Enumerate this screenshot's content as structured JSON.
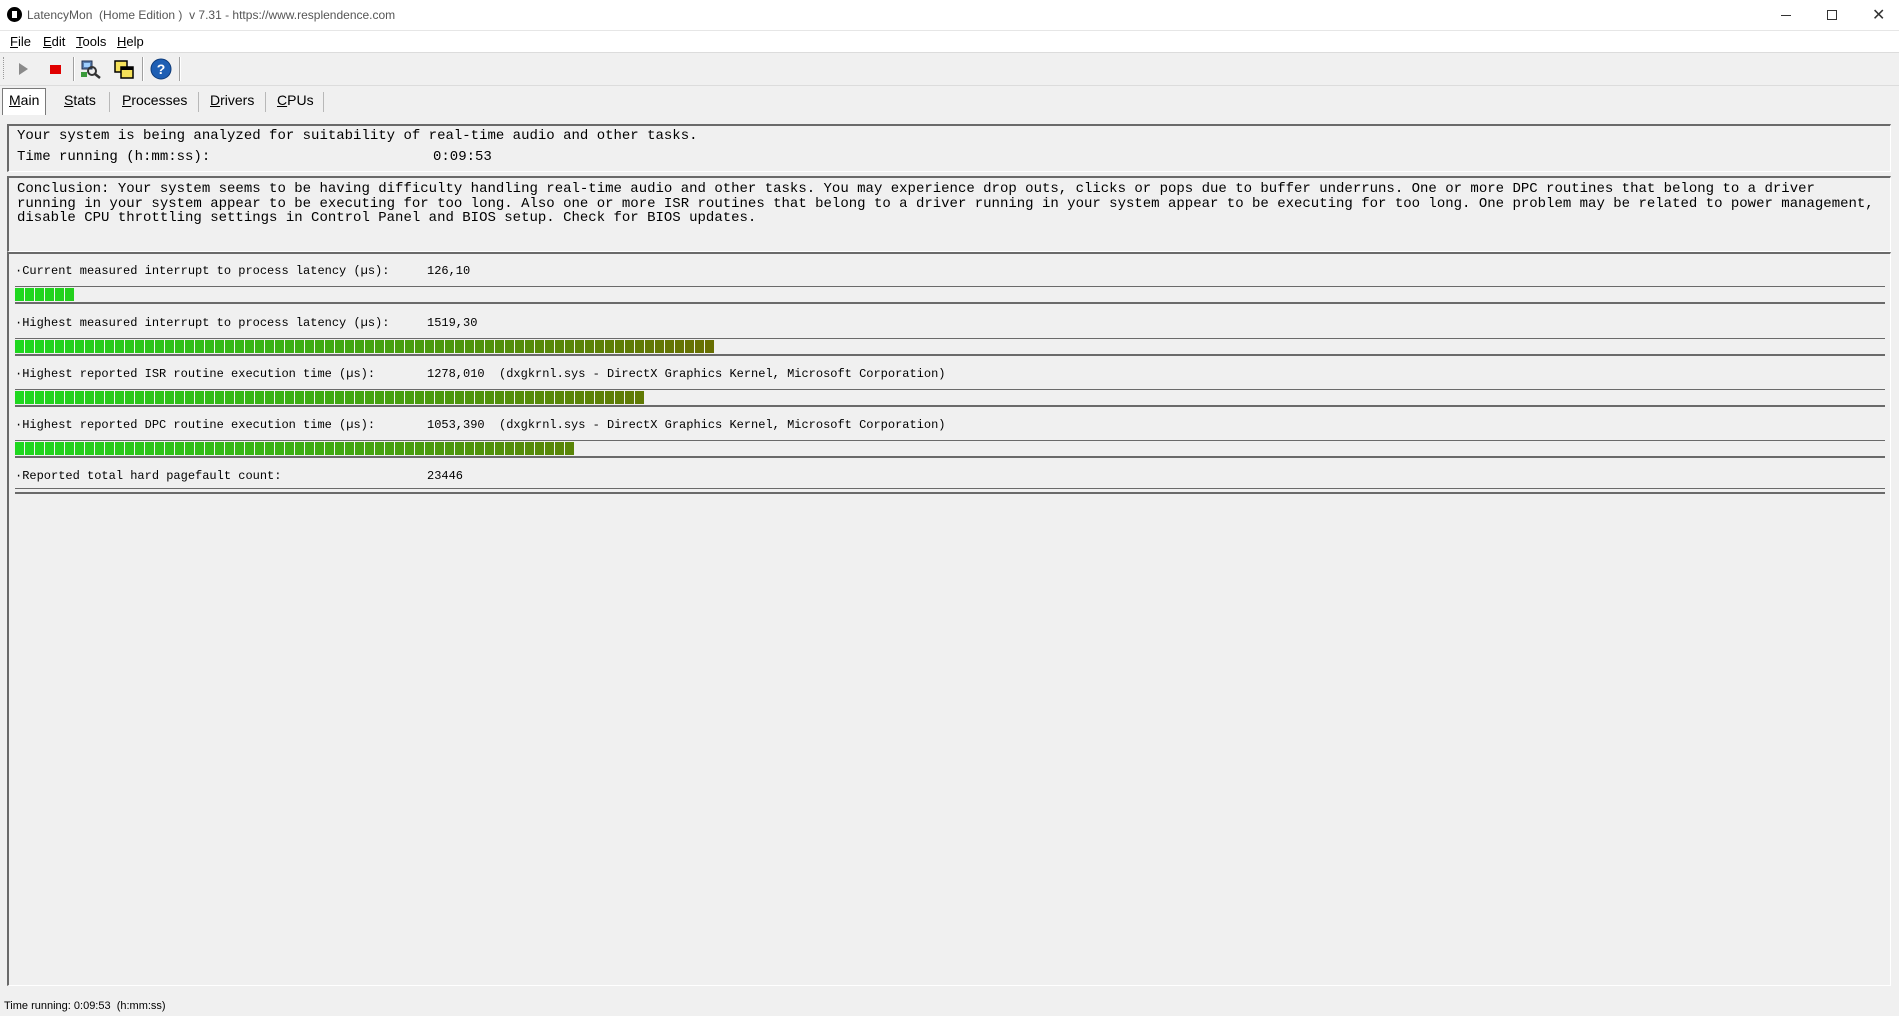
{
  "window": {
    "title": "LatencyMon  (Home Edition )  v 7.31 - https://www.resplendence.com",
    "close_glyph": "✕"
  },
  "menu": {
    "file": {
      "first": "F",
      "rest": "ile"
    },
    "edit": {
      "first": "E",
      "rest": "dit"
    },
    "tools": {
      "first": "T",
      "rest": "ools"
    },
    "help": {
      "first": "H",
      "rest": "elp"
    }
  },
  "toolbar": {
    "icons": [
      "play-icon",
      "stop-icon",
      "network-search-icon",
      "copy-windows-icon",
      "help-icon"
    ],
    "stop_color": "#e00000",
    "help_color": "#1e5fb4"
  },
  "tabs": [
    {
      "first": "M",
      "rest": "ain",
      "active": true
    },
    {
      "first": "S",
      "rest": "tats",
      "active": false
    },
    {
      "first": "P",
      "rest": "rocesses",
      "active": false
    },
    {
      "first": "D",
      "rest": "rivers",
      "active": false
    },
    {
      "first": "C",
      "rest": "PUs",
      "active": false
    }
  ],
  "summary": {
    "analysis_text": "Your system is being analyzed for suitability of real-time audio and other tasks.",
    "time_label": "Time running (h:mm:ss):",
    "time_value": "0:09:53"
  },
  "conclusion": "Conclusion: Your system seems to be having difficulty handling real-time audio and other tasks. You may experience drop outs, clicks or pops due to buffer underruns. One or more DPC routines that belong to a driver running in your system appear to be executing for too long. Also one or more ISR routines that belong to a driver running in your system appear to be executing for too long. One problem may be related to power management, disable CPU throttling settings in Control Panel and BIOS setup. Check for BIOS updates.",
  "metrics": [
    {
      "label": "·Current measured interrupt to process latency (µs):",
      "value": "126,10",
      "detail": "",
      "fill_fraction": 0.034
    },
    {
      "label": "·Highest measured interrupt to process latency (µs):",
      "value": "1519,30",
      "detail": "",
      "fill_fraction": 0.378
    },
    {
      "label": "·Highest reported ISR routine execution time (µs):",
      "value": "1278,010",
      "detail": "(dxgkrnl.sys - DirectX Graphics Kernel, Microsoft Corporation)",
      "fill_fraction": 0.34
    },
    {
      "label": "·Highest reported DPC routine execution time (µs):",
      "value": "1053,390",
      "detail": "(dxgkrnl.sys - DirectX Graphics Kernel, Microsoft Corporation)",
      "fill_fraction": 0.301
    },
    {
      "label": "·Reported total hard pagefault count:",
      "value": "23446",
      "detail": "",
      "fill_fraction": 0
    }
  ],
  "colors": {
    "meter_green": "#1ed81e",
    "meter_olive": "#6b6b00"
  },
  "status": {
    "text": "Time running: 0:09:53  (h:mm:ss)"
  }
}
